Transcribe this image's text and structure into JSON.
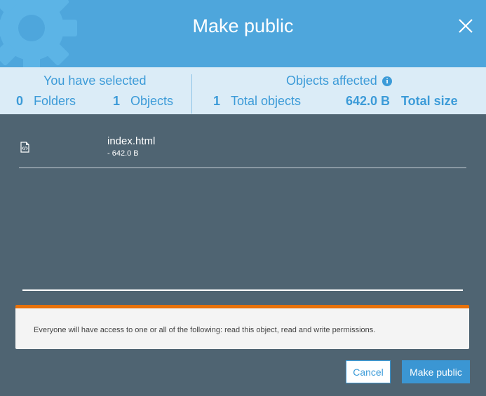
{
  "dialog": {
    "title": "Make public"
  },
  "summary": {
    "selected": {
      "heading": "You have selected",
      "folders_count": "0",
      "folders_label": "Folders",
      "objects_count": "1",
      "objects_label": "Objects"
    },
    "affected": {
      "heading": "Objects affected",
      "total_objects_count": "1",
      "total_objects_label": "Total objects",
      "total_size_value": "642.0 B",
      "total_size_label": "Total size",
      "info_icon": "i"
    }
  },
  "files": [
    {
      "name": "index.html",
      "size": "- 642.0 B",
      "icon": "code-file-icon"
    }
  ],
  "warning": {
    "text": "Everyone will have access to one or all of the following: read this object, read and write permissions."
  },
  "footer": {
    "cancel_label": "Cancel",
    "confirm_label": "Make public"
  },
  "colors": {
    "header": "#4ea6dc",
    "body": "#4f6472",
    "summary_band": "#dbecf7",
    "accent": "#3c9bd8",
    "warning_border": "#e8710a"
  }
}
